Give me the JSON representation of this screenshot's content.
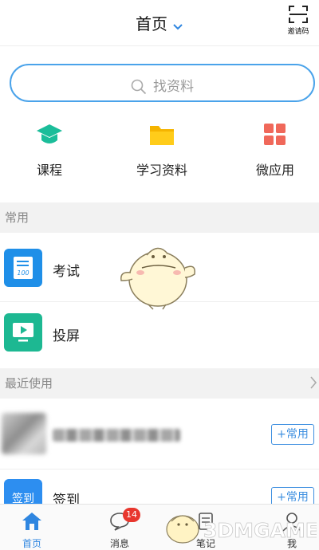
{
  "header": {
    "title": "首页",
    "invite_label": "邀请码"
  },
  "search": {
    "placeholder": "找资料"
  },
  "quick_menu": [
    {
      "label": "课程",
      "icon": "graduation-cap-icon",
      "color": "#1bbd9a"
    },
    {
      "label": "学习资料",
      "icon": "folder-icon",
      "color": "#f5b400"
    },
    {
      "label": "微应用",
      "icon": "grid-icon",
      "color": "#f0685a"
    }
  ],
  "common": {
    "heading": "常用",
    "items": [
      {
        "label": "考试",
        "icon": "exam-icon",
        "tile_text": "100",
        "color": "#1f8fe8"
      },
      {
        "label": "投屏",
        "icon": "screen-cast-icon",
        "color": "#1db892"
      }
    ]
  },
  "recent": {
    "heading": "最近使用",
    "items": [
      {
        "label": "",
        "action": "+常用"
      },
      {
        "label": "签到",
        "tile_text": "签到",
        "action": "+常用",
        "color": "#2d8ef0"
      }
    ]
  },
  "bottom_nav": [
    {
      "label": "首页",
      "icon": "home-icon",
      "active": true
    },
    {
      "label": "消息",
      "icon": "chat-bubble-icon",
      "badge": "14"
    },
    {
      "label": "笔记",
      "icon": "note-icon"
    },
    {
      "label": "我",
      "icon": "user-icon"
    }
  ],
  "watermark": {
    "text": "3DMGAME"
  },
  "colors": {
    "accent": "#2f86e0",
    "search_border": "#4aa3ea",
    "badge": "#e8362d"
  }
}
